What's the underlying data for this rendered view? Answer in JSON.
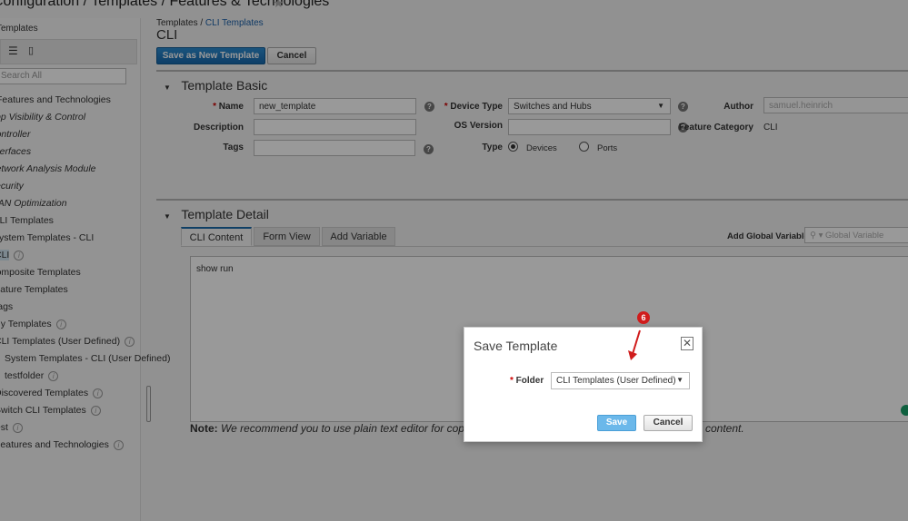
{
  "header": {
    "title": "Configuration / Templates / Features & Technologies"
  },
  "sidebar": {
    "heading": "Templates",
    "search_placeholder": "Search All",
    "items": [
      {
        "label": "Features and Technologies",
        "italic": false
      },
      {
        "label": "App Visibility & Control",
        "italic": true
      },
      {
        "label": "Controller",
        "italic": true
      },
      {
        "label": "Interfaces",
        "italic": true
      },
      {
        "label": "Network Analysis Module",
        "italic": true
      },
      {
        "label": "Security",
        "italic": true
      },
      {
        "label": "WAN Optimization",
        "italic": true
      },
      {
        "label": "CLI Templates",
        "italic": false
      },
      {
        "label": "System Templates - CLI",
        "italic": false
      },
      {
        "label": "CLI",
        "italic": false,
        "selected": true
      },
      {
        "label": "Composite Templates",
        "italic": false
      },
      {
        "label": "Feature Templates",
        "italic": false
      },
      {
        "label": "Tags",
        "italic": false
      },
      {
        "label": "My Templates",
        "italic": false
      },
      {
        "label": "CLI Templates (User Defined)",
        "italic": false
      },
      {
        "label": "System Templates - CLI (User Defined)",
        "italic": false
      },
      {
        "label": "testfolder",
        "italic": false
      },
      {
        "label": "Discovered Templates",
        "italic": false
      },
      {
        "label": "Switch CLI Templates",
        "italic": false
      },
      {
        "label": "test",
        "italic": false
      },
      {
        "label": "Features and Technologies",
        "italic": false
      }
    ]
  },
  "breadcrumb": {
    "root": "Templates",
    "sep": " / ",
    "current": "CLI Templates"
  },
  "page": {
    "title": "CLI",
    "save_new": "Save as New Template",
    "cancel": "Cancel"
  },
  "basic": {
    "title": "Template Basic",
    "name_label": "Name",
    "name_value": "new_template",
    "desc_label": "Description",
    "tags_label": "Tags",
    "device_type_label": "Device Type",
    "device_type_value": "Switches and Hubs",
    "os_label": "OS Version",
    "type_label": "Type",
    "type_devices": "Devices",
    "type_ports": "Ports",
    "type_selected": "Devices",
    "author_label": "Author",
    "author_value": "samuel.heinrich",
    "feature_cat_label": "Feature Category",
    "feature_cat_value": "CLI"
  },
  "detail": {
    "title": "Template Detail",
    "tabs": [
      "CLI Content",
      "Form View",
      "Add Variable"
    ],
    "active_tab": "CLI Content",
    "global_var_label": "Add Global Variable",
    "global_var_placeholder": "Global Variable",
    "content": "show run",
    "note_label": "Note:",
    "note_text": "We recommend you to use plain text editor for copying",
    "note_tail": "content."
  },
  "dialog": {
    "title": "Save Template",
    "folder_label": "Folder",
    "folder_value": "CLI Templates (User Defined)",
    "save": "Save",
    "cancel": "Cancel"
  },
  "annotation": {
    "step": "6",
    "color": "#d01c1c"
  }
}
